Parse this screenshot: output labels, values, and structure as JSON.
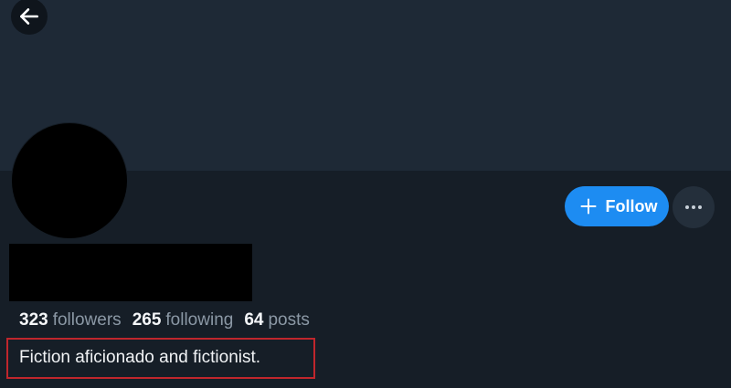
{
  "header": {
    "back_icon": "arrow-left-icon"
  },
  "profile": {
    "follow_label": "Follow",
    "follow_icon": "plus-icon",
    "more_icon": "ellipsis-icon",
    "bio": "Fiction aficionado and fictionist."
  },
  "stats": [
    {
      "count": "323",
      "label": "followers"
    },
    {
      "count": "265",
      "label": "following"
    },
    {
      "count": "64",
      "label": "posts"
    }
  ],
  "colors": {
    "accent": "#1d8cf2",
    "highlight_border": "#c0262c",
    "background": "#161e27",
    "banner": "#1e2936"
  }
}
